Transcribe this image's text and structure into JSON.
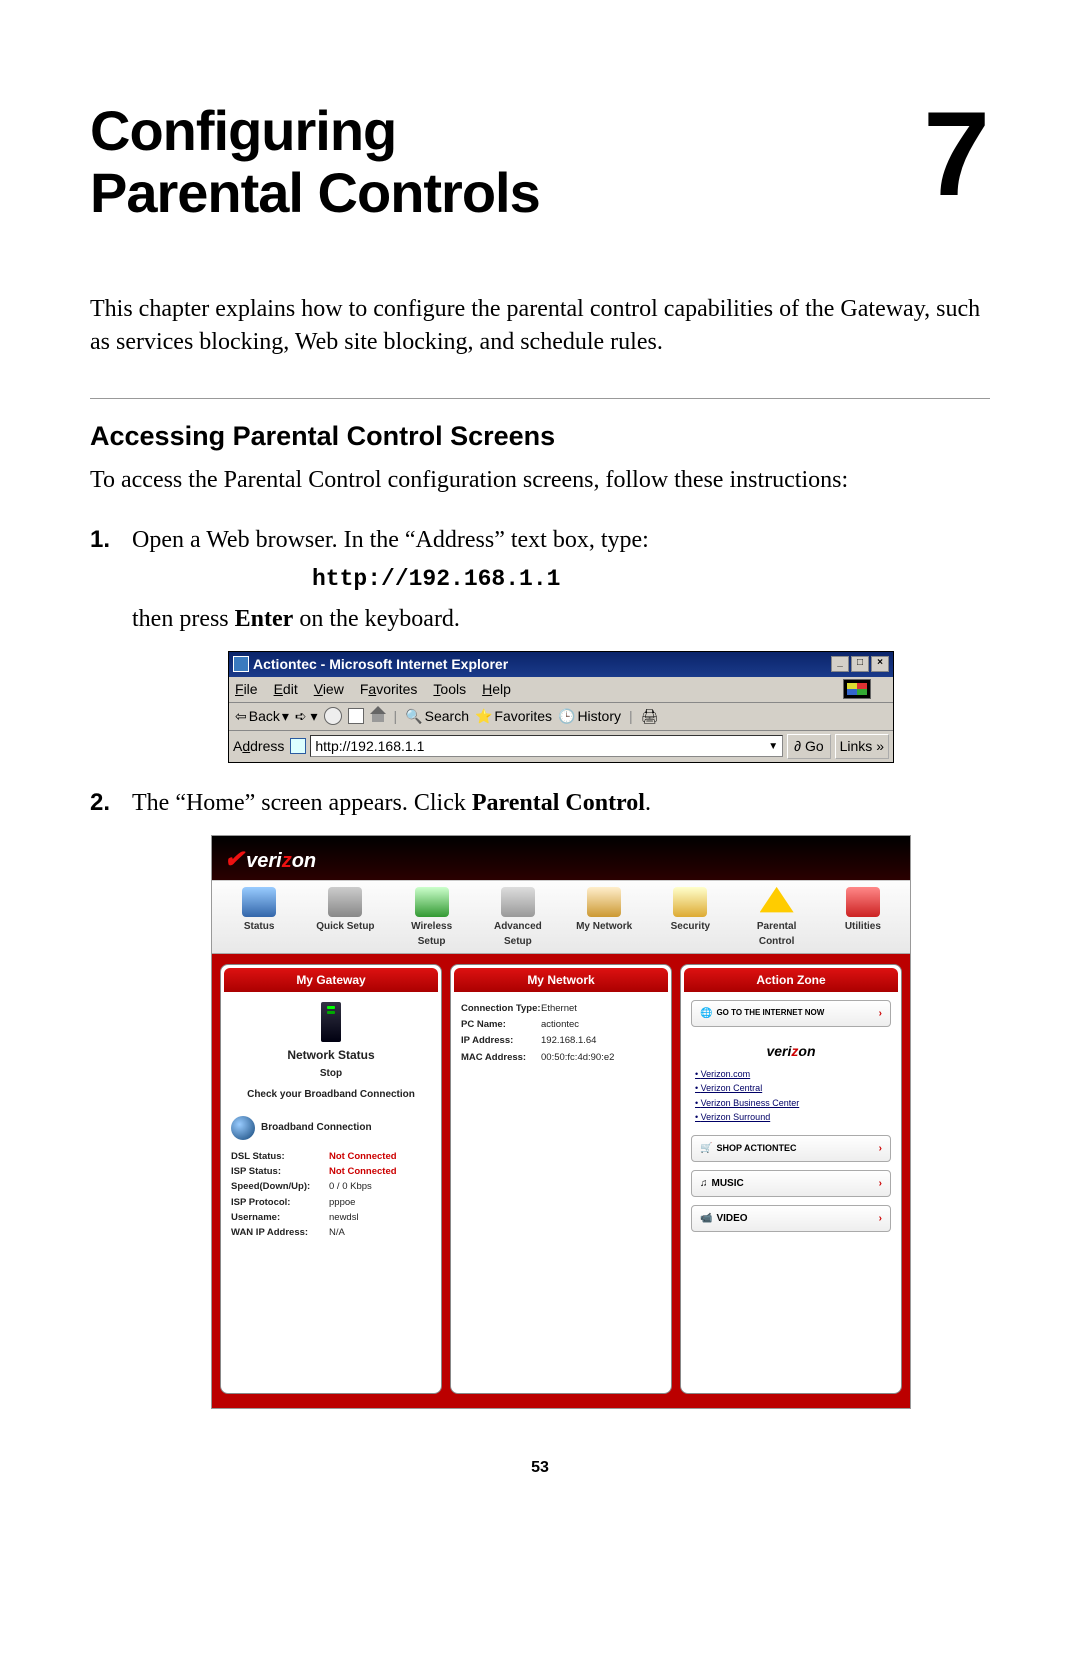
{
  "chapter": {
    "title_line1": "Configuring",
    "title_line2": "Parental Controls",
    "number": "7"
  },
  "intro": "This chapter explains how to configure the parental control capabilities of the Gateway, such as services blocking, Web site blocking, and schedule rules.",
  "section": {
    "heading": "Accessing Parental Control Screens",
    "intro": "To access the Parental Control configuration screens, follow these instructions:"
  },
  "steps": [
    {
      "num": "1.",
      "pre": "Open a Web browser. In the “Address” text box, type:",
      "mono": "http://192.168.1.1",
      "post_a": "then press ",
      "post_bold": "Enter",
      "post_b": " on the keyboard."
    },
    {
      "num": "2.",
      "pre": "The “Home” screen appears. Click ",
      "bold": "Parental Control",
      "post": "."
    }
  ],
  "ie": {
    "title": "Actiontec - Microsoft Internet Explorer",
    "win_min": "_",
    "win_max": "□",
    "win_close": "×",
    "menus": [
      "File",
      "Edit",
      "View",
      "Favorites",
      "Tools",
      "Help"
    ],
    "back": "Back",
    "search": "Search",
    "favorites": "Favorites",
    "history": "History",
    "address_label": "Address",
    "address_value": "http://192.168.1.1",
    "go": "Go",
    "links": "Links",
    "links_chev": "»"
  },
  "vz": {
    "logo": "verizon",
    "nav": [
      "Status",
      "Quick Setup",
      "Wireless Setup",
      "Advanced Setup",
      "My Network",
      "Security",
      "Parental Control",
      "Utilities"
    ],
    "panels": {
      "gateway": {
        "title": "My Gateway",
        "ns_title": "Network Status",
        "stop": "Stop",
        "check": "Check your Broadband Connection",
        "bb": "Broadband Connection",
        "rows": [
          {
            "k": "DSL Status:",
            "v": "Not Connected",
            "red": true
          },
          {
            "k": "ISP Status:",
            "v": "Not Connected",
            "red": true
          },
          {
            "k": "Speed(Down/Up):",
            "v": "0 / 0 Kbps"
          },
          {
            "k": "ISP Protocol:",
            "v": "pppoe"
          },
          {
            "k": "Username:",
            "v": "newdsl"
          },
          {
            "k": "WAN IP Address:",
            "v": "N/A"
          }
        ]
      },
      "network": {
        "title": "My Network",
        "rows": [
          {
            "k": "Connection Type:",
            "v": "Ethernet"
          },
          {
            "k": "PC Name:",
            "v": "actiontec"
          },
          {
            "k": "IP Address:",
            "v": "192.168.1.64"
          },
          {
            "k": "MAC Address:",
            "v": "00:50:fc:4d:90:e2"
          }
        ]
      },
      "action": {
        "title": "Action Zone",
        "go_internet": "GO TO THE INTERNET NOW",
        "links": [
          "Verizon.com",
          "Verizon Central",
          "Verizon Business Center",
          "Verizon Surround"
        ],
        "shop": "SHOP ACTIONTEC",
        "music": "MUSIC",
        "video": "VIDEO"
      }
    }
  },
  "page_number": "53"
}
